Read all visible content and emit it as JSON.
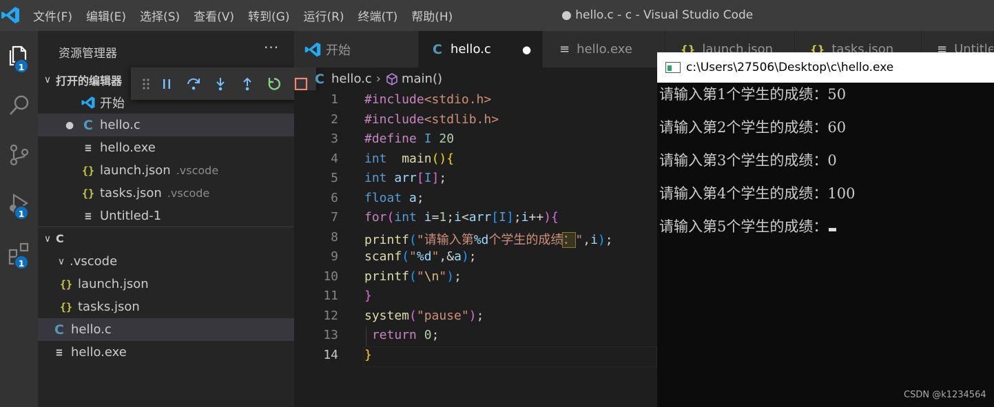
{
  "window": {
    "title": "● hello.c - c - Visual Studio Code",
    "menu": [
      "文件(F)",
      "编辑(E)",
      "选择(S)",
      "查看(V)",
      "转到(G)",
      "运行(R)",
      "终端(T)",
      "帮助(H)"
    ]
  },
  "activity": {
    "badges": {
      "explorer": "1",
      "run": "1",
      "extensions": "1"
    }
  },
  "sidebar": {
    "title": "资源管理器",
    "more": "···",
    "open_editors": {
      "label": "打开的编辑器",
      "items": [
        {
          "label": "开始",
          "desc": "",
          "icon": "vscode-icon"
        },
        {
          "label": "hello.c",
          "desc": "",
          "icon": "c-file-icon",
          "dirty": "●"
        },
        {
          "label": "hello.exe",
          "desc": "",
          "icon": "text-file-icon"
        },
        {
          "label": "launch.json",
          "desc": ".vscode",
          "icon": "json-file-icon"
        },
        {
          "label": "tasks.json",
          "desc": ".vscode",
          "icon": "json-file-icon"
        },
        {
          "label": "Untitled-1",
          "desc": "",
          "icon": "text-file-icon"
        }
      ]
    },
    "folder": {
      "label": "C",
      "subfolder": ".vscode",
      "items": [
        {
          "label": "launch.json"
        },
        {
          "label": "tasks.json"
        },
        {
          "label": "hello.c"
        },
        {
          "label": "hello.exe"
        }
      ]
    }
  },
  "tabs": [
    {
      "label": "开始"
    },
    {
      "label": "hello.c",
      "dirty": "●"
    },
    {
      "label": "hello.exe"
    },
    {
      "label": "launch.json"
    },
    {
      "label": "tasks.json"
    },
    {
      "label": "Untitled"
    }
  ],
  "breadcrumb": {
    "file": "hello.c",
    "symbol": "main()"
  },
  "editor": {
    "line_numbers": [
      "1",
      "2",
      "3",
      "4",
      "5",
      "6",
      "7",
      "8",
      "9",
      "10",
      "11",
      "12",
      "13",
      "14"
    ],
    "current_line": "14"
  },
  "console": {
    "title": "c:\\Users\\27506\\Desktop\\c\\hello.exe",
    "lines": [
      "请输入第1个学生的成绩：50",
      "请输入第2个学生的成绩：60",
      "请输入第3个学生的成绩：0",
      "请输入第4个学生的成绩：100",
      "请输入第5个学生的成绩："
    ]
  },
  "watermark": "CSDN @k1234564",
  "colors": {
    "accent": "#0e70c0",
    "titlebar": "#3c3c3c",
    "sidebar": "#252526",
    "editor": "#1e1e1e"
  }
}
